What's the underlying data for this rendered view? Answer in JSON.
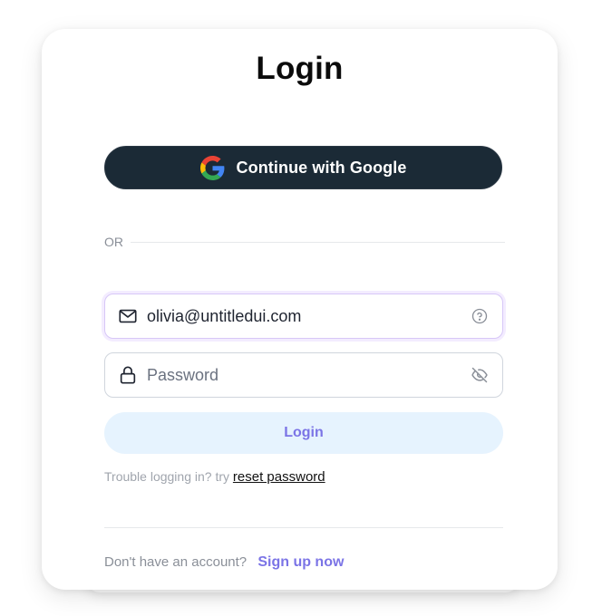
{
  "login": {
    "title": "Login",
    "google_button_label": "Continue with Google",
    "or_label": "OR",
    "email": {
      "value": "olivia@untitledui.com"
    },
    "password": {
      "placeholder": "Password"
    },
    "submit_label": "Login",
    "trouble_text": "Trouble logging in? try ",
    "reset_link": "reset password",
    "no_account_text": "Don't have an account?",
    "signup_link": "Sign up now"
  },
  "colors": {
    "google_button_bg": "#1b2a36",
    "login_button_bg": "#e6f3fe",
    "accent": "#7b74e6",
    "email_focus_border": "#d7c7f7"
  },
  "icons": {
    "google": "google-logo-icon",
    "email": "mail-icon",
    "help": "help-circle-icon",
    "lock": "lock-icon",
    "toggle_visibility": "eye-off-icon"
  }
}
